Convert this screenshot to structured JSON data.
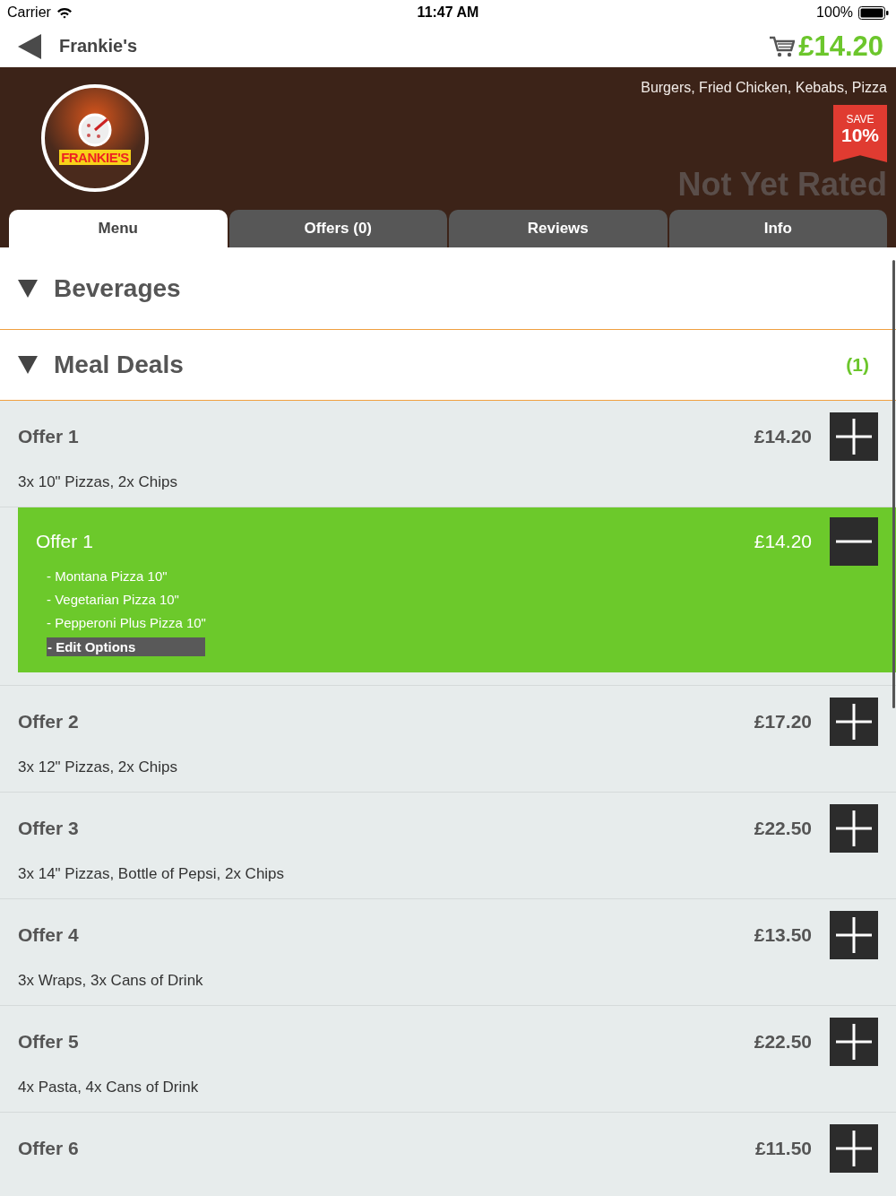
{
  "status_bar": {
    "carrier": "Carrier",
    "time": "11:47 AM",
    "battery": "100%"
  },
  "nav": {
    "title": "Frankie's",
    "cart_total": "£14.20"
  },
  "header": {
    "logo_text": "FRANKIE'S",
    "cuisines": "Burgers, Fried Chicken, Kebabs, Pizza",
    "save_label": "SAVE",
    "save_value": "10%",
    "rating": "Not Yet Rated"
  },
  "tabs": [
    {
      "label": "Menu",
      "selected": true
    },
    {
      "label": "Offers (0)",
      "selected": false
    },
    {
      "label": "Reviews",
      "selected": false
    },
    {
      "label": "Info",
      "selected": false
    }
  ],
  "sections": [
    {
      "title": "Beverages",
      "expanded": true
    },
    {
      "title": "Meal Deals",
      "expanded": true,
      "count": "(1)",
      "items": [
        {
          "kind": "offer",
          "name": "Offer 1",
          "price": "£14.20",
          "description": "3x 10\" Pizzas, 2x Chips"
        },
        {
          "kind": "selection",
          "name": "Offer 1",
          "price": "£14.20",
          "options": [
            "- Montana Pizza 10\"",
            "- Vegetarian Pizza 10\"",
            "- Pepperoni Plus Pizza 10\""
          ],
          "edit_label": "- Edit Options"
        },
        {
          "kind": "offer",
          "name": "Offer 2",
          "price": "£17.20",
          "description": "3x 12\" Pizzas, 2x Chips"
        },
        {
          "kind": "offer",
          "name": "Offer 3",
          "price": "£22.50",
          "description": "3x 14\" Pizzas, Bottle of Pepsi, 2x Chips"
        },
        {
          "kind": "offer",
          "name": "Offer 4",
          "price": "£13.50",
          "description": "3x Wraps, 3x Cans of Drink"
        },
        {
          "kind": "offer",
          "name": "Offer 5",
          "price": "£22.50",
          "description": "4x Pasta, 4x Cans of Drink"
        },
        {
          "kind": "offer",
          "name": "Offer 6",
          "price": "£11.50"
        }
      ]
    }
  ]
}
